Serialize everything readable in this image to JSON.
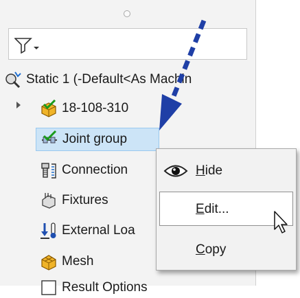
{
  "tree": {
    "root_label": "Static 1 (-Default<As Machin",
    "items": [
      {
        "label": "18-108-310",
        "icon": "part-check-icon"
      },
      {
        "label": "Joint group",
        "icon": "joint-group-icon"
      },
      {
        "label": "Connection",
        "icon": "connection-icon"
      },
      {
        "label": "Fixtures",
        "icon": "fixtures-icon"
      },
      {
        "label": "External Loa",
        "icon": "external-loads-icon"
      },
      {
        "label": "Mesh",
        "icon": "mesh-icon"
      },
      {
        "label": "Result Options",
        "icon": "result-options-icon"
      }
    ]
  },
  "context_menu": {
    "items": [
      {
        "label": "Hide",
        "underline": "H",
        "rest": "ide",
        "icon": "eye-icon"
      },
      {
        "label": "Edit...",
        "underline": "E",
        "rest": "dit..."
      },
      {
        "label": "Copy",
        "underline": "C",
        "rest": "opy"
      }
    ]
  },
  "colors": {
    "selection": "#cce4f7",
    "arrow": "#1f3fa6",
    "panel": "#f3f3f3"
  }
}
